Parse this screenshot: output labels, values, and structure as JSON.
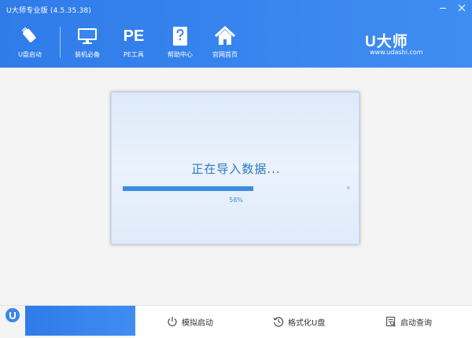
{
  "window": {
    "title": "U大师专业版 (4.5.35.38)",
    "minimize_icon": "minimize-icon",
    "close_icon": "close-icon"
  },
  "nav": {
    "items": [
      {
        "label": "U盘启动",
        "icon": "usb-drive-icon"
      },
      {
        "label": "装机必备",
        "icon": "monitor-icon"
      },
      {
        "label": "PE工具",
        "icon": "pe-text-icon",
        "icon_text": "PE"
      },
      {
        "label": "帮助中心",
        "icon": "help-question-icon"
      },
      {
        "label": "官网首页",
        "icon": "home-icon"
      }
    ]
  },
  "brand": {
    "name": "U大师",
    "url": "www.udashi.com"
  },
  "dialog": {
    "title": "正在导入数据...",
    "progress_percent": 58,
    "progress_text": "58%"
  },
  "footer": {
    "logo_icon": "udashi-logo-icon",
    "buttons": [
      {
        "label": "模拟启动",
        "icon": "power-icon"
      },
      {
        "label": "格式化U盘",
        "icon": "history-icon"
      },
      {
        "label": "启动查询",
        "icon": "search-document-icon"
      }
    ]
  },
  "colors": {
    "header_blue": "#3a86ef",
    "accent": "#3b8de0",
    "dialog_title": "#2f78c4"
  }
}
